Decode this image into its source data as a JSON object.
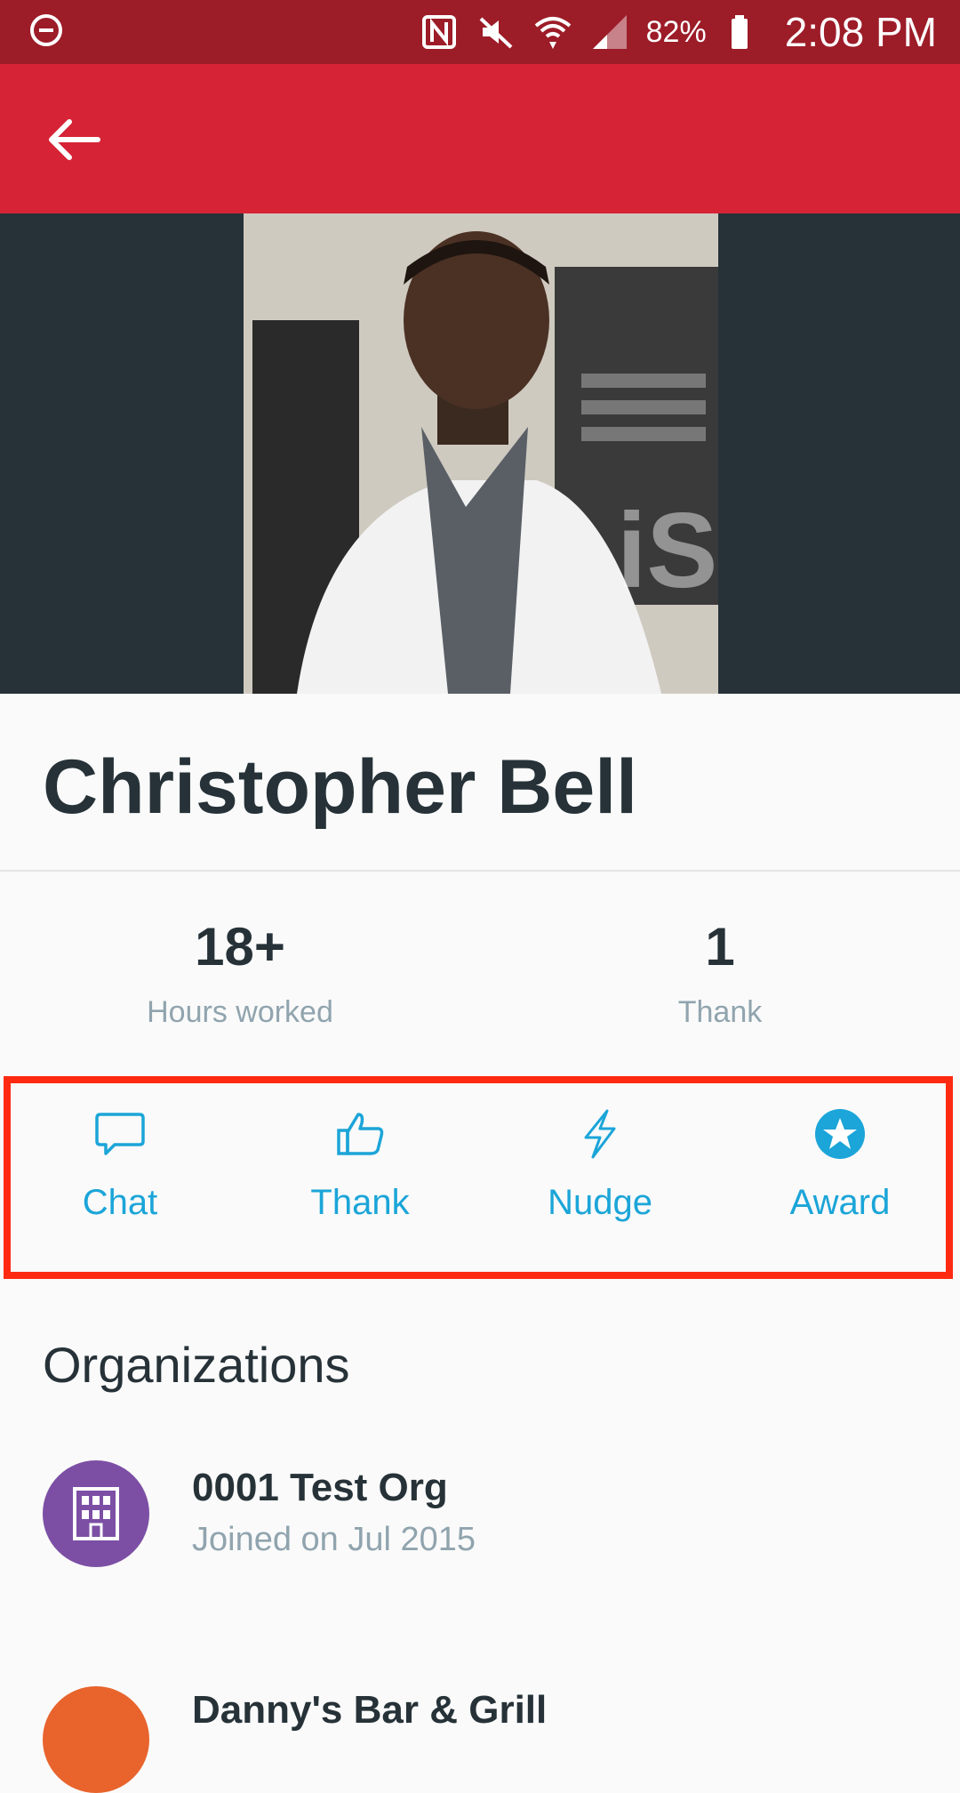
{
  "status_bar": {
    "battery_percent": "82%",
    "time": "2:08 PM",
    "icons": [
      "do-not-disturb-icon",
      "nfc-icon",
      "mute-icon",
      "wifi-icon",
      "signal-icon",
      "battery-icon"
    ]
  },
  "app_bar": {
    "back_icon": "arrow-left-icon",
    "color": "#d62436"
  },
  "profile": {
    "name": "Christopher Bell",
    "stats": [
      {
        "value": "18+",
        "label": "Hours worked"
      },
      {
        "value": "1",
        "label": "Thank"
      }
    ]
  },
  "actions": [
    {
      "label": "Chat",
      "icon": "chat-bubble-icon"
    },
    {
      "label": "Thank",
      "icon": "thumbs-up-icon"
    },
    {
      "label": "Nudge",
      "icon": "lightning-icon"
    },
    {
      "label": "Award",
      "icon": "star-badge-icon"
    }
  ],
  "organizations": {
    "title": "Organizations",
    "items": [
      {
        "name": "0001 Test Org",
        "joined": "Joined on Jul 2015",
        "avatar_color": "#7c4fa5",
        "icon": "building-icon"
      },
      {
        "name": "Danny's Bar & Grill",
        "avatar_color": "#e8642c"
      }
    ]
  },
  "colors": {
    "accent": "#1ba5d8",
    "highlight_box": "#ff2a12",
    "status_bar": "#9c1c28"
  }
}
